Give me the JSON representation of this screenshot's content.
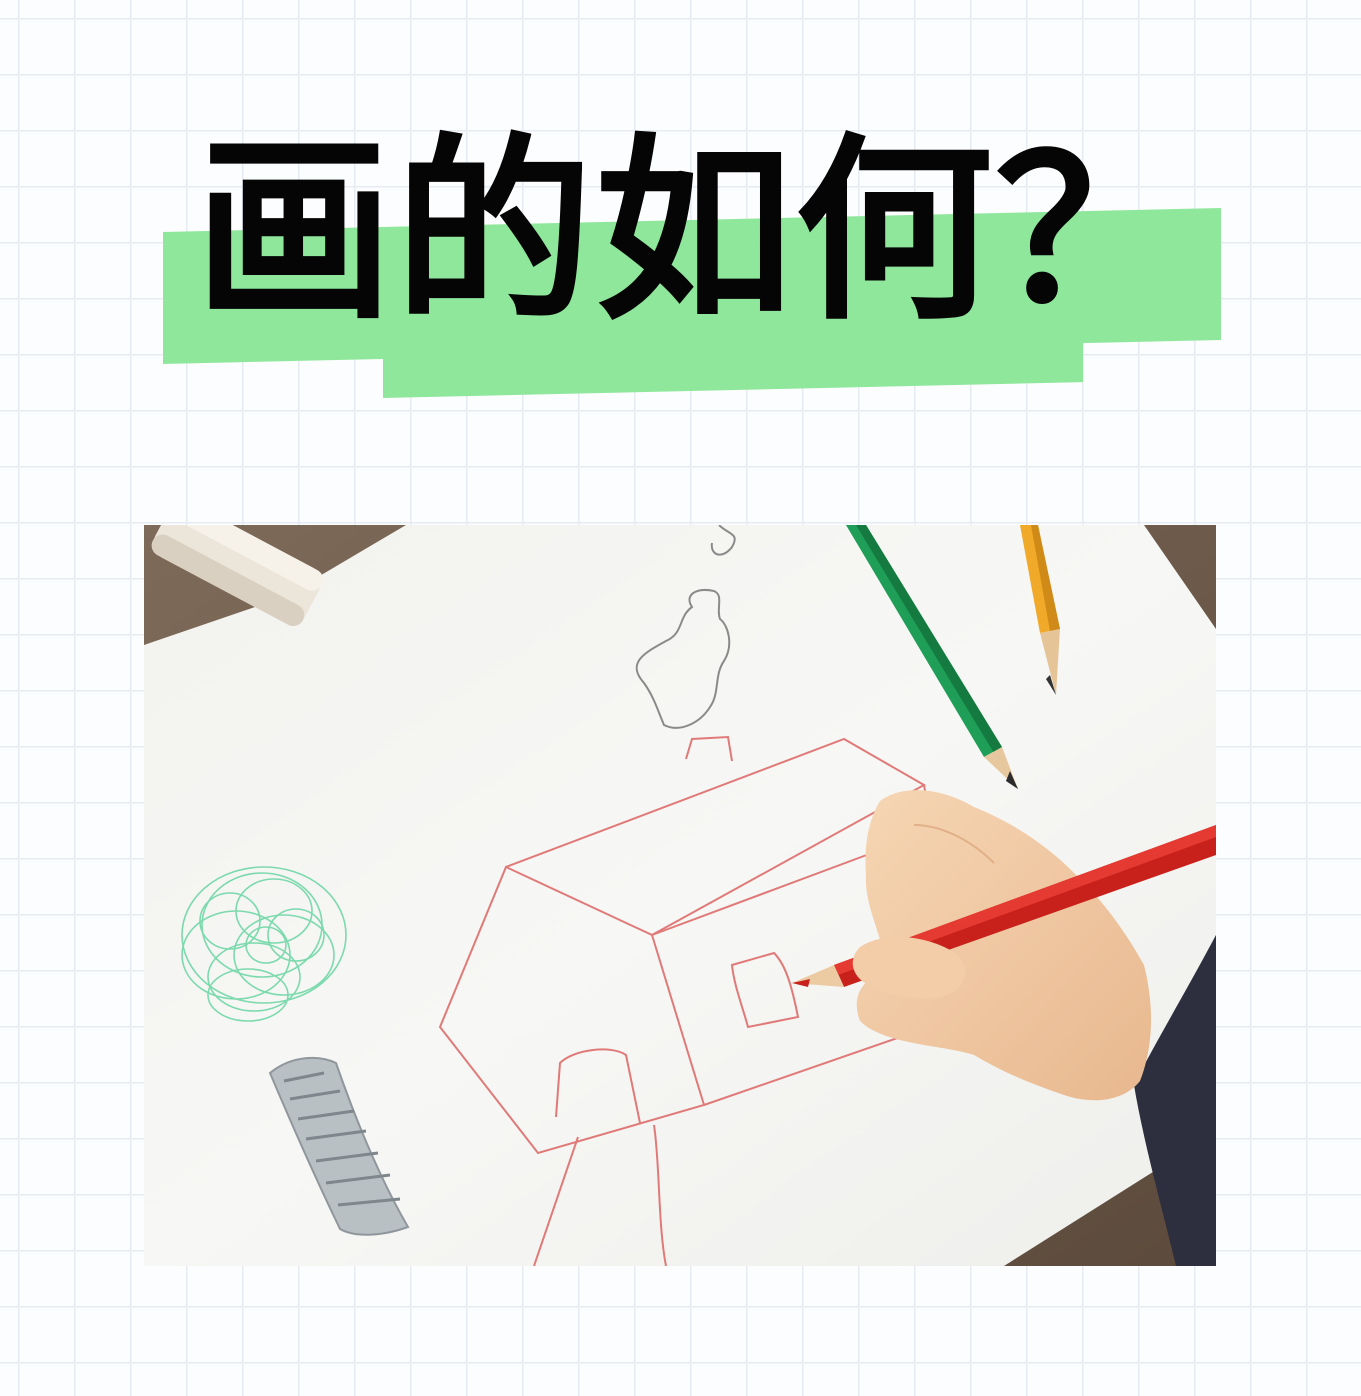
{
  "title": "画的如何？",
  "colors": {
    "highlight": "#8fe79c",
    "title_text": "#050505",
    "grid_line": "#e6ebf2",
    "background": "#fcfdfe"
  },
  "photo": {
    "subject": "child-drawing-house"
  }
}
